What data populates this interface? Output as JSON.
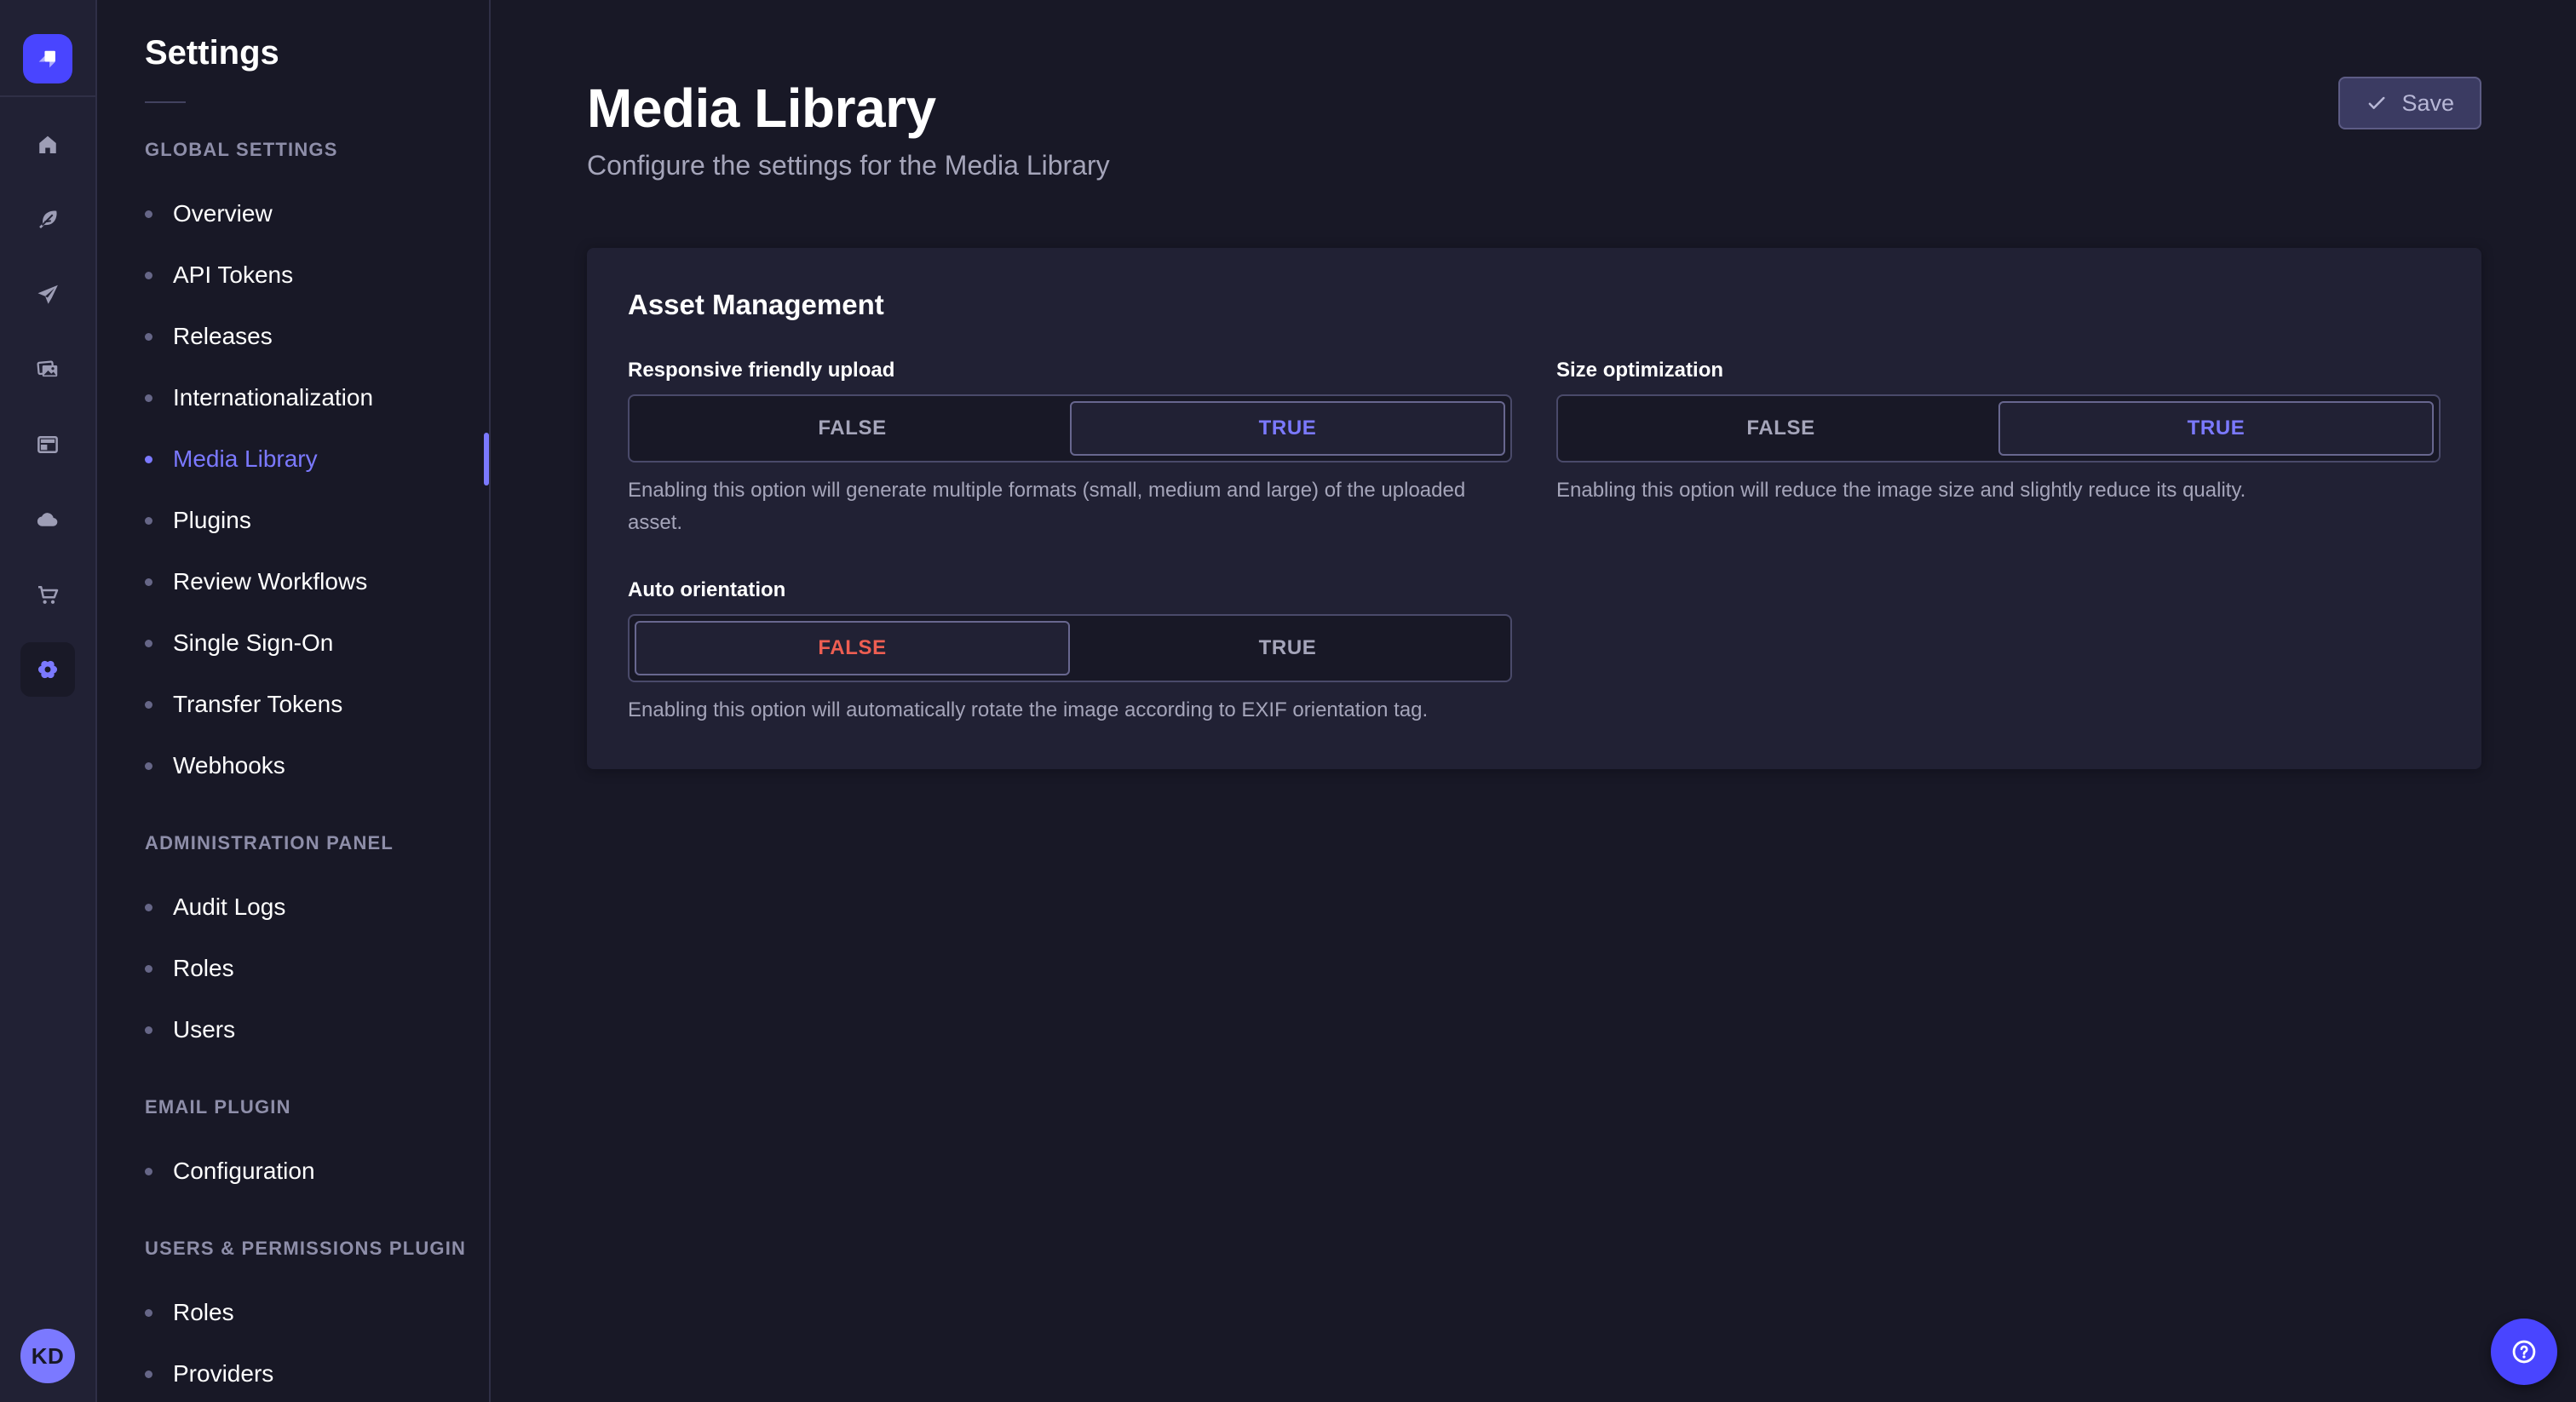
{
  "colors": {
    "primary": "#4945ff",
    "primary_light": "#7b79ff",
    "danger": "#ee5e52",
    "background": "#181826",
    "panel": "#212134"
  },
  "rail": {
    "logo_icon": "strapi-logo",
    "icons": [
      {
        "name": "home",
        "active": false
      },
      {
        "name": "feather",
        "active": false
      },
      {
        "name": "paper-plane",
        "active": false
      },
      {
        "name": "pictures",
        "active": false
      },
      {
        "name": "layout",
        "active": false
      },
      {
        "name": "cloud",
        "active": false
      },
      {
        "name": "cart",
        "active": false
      },
      {
        "name": "gear",
        "active": true
      }
    ],
    "avatar_initials": "KD"
  },
  "subnav": {
    "title": "Settings",
    "sections": [
      {
        "label": "GLOBAL SETTINGS",
        "items": [
          {
            "label": "Overview",
            "active": false
          },
          {
            "label": "API Tokens",
            "active": false
          },
          {
            "label": "Releases",
            "active": false
          },
          {
            "label": "Internationalization",
            "active": false
          },
          {
            "label": "Media Library",
            "active": true
          },
          {
            "label": "Plugins",
            "active": false
          },
          {
            "label": "Review Workflows",
            "active": false
          },
          {
            "label": "Single Sign-On",
            "active": false
          },
          {
            "label": "Transfer Tokens",
            "active": false
          },
          {
            "label": "Webhooks",
            "active": false
          }
        ]
      },
      {
        "label": "ADMINISTRATION PANEL",
        "items": [
          {
            "label": "Audit Logs",
            "active": false
          },
          {
            "label": "Roles",
            "active": false
          },
          {
            "label": "Users",
            "active": false
          }
        ]
      },
      {
        "label": "EMAIL PLUGIN",
        "items": [
          {
            "label": "Configuration",
            "active": false
          }
        ]
      },
      {
        "label": "USERS & PERMISSIONS PLUGIN",
        "items": [
          {
            "label": "Roles",
            "active": false
          },
          {
            "label": "Providers",
            "active": false
          }
        ]
      }
    ]
  },
  "header": {
    "title": "Media Library",
    "subtitle": "Configure the settings for the Media Library",
    "save_label": "Save",
    "save_icon": "check"
  },
  "card": {
    "heading": "Asset Management",
    "fields": [
      {
        "label": "Responsive friendly upload",
        "options": [
          "FALSE",
          "TRUE"
        ],
        "value": "TRUE",
        "hint": "Enabling this option will generate multiple formats (small, medium and large) of the uploaded asset."
      },
      {
        "label": "Size optimization",
        "options": [
          "FALSE",
          "TRUE"
        ],
        "value": "TRUE",
        "hint": "Enabling this option will reduce the image size and slightly reduce its quality."
      },
      {
        "label": "Auto orientation",
        "options": [
          "FALSE",
          "TRUE"
        ],
        "value": "FALSE",
        "hint": "Enabling this option will automatically rotate the image according to EXIF orientation tag."
      }
    ]
  },
  "help": {
    "icon": "question-mark"
  }
}
